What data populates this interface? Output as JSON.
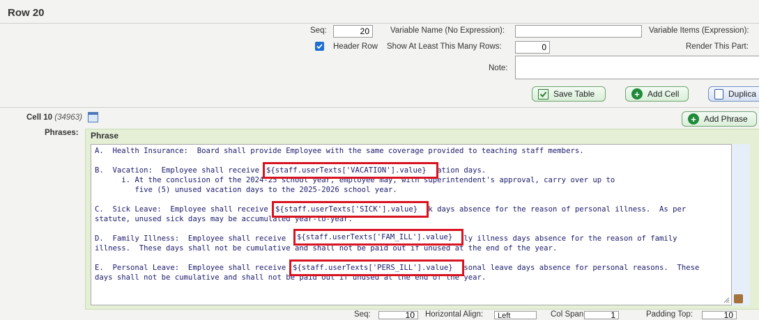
{
  "header": {
    "title": "Row 20"
  },
  "row_form": {
    "seq_label": "Seq:",
    "seq_value": "20",
    "variable_name_label": "Variable Name (No Expression):",
    "variable_name_value": "",
    "variable_items_label": "Variable Items (Expression):",
    "header_row_label": "Header Row",
    "header_row_checked": true,
    "show_rows_label": "Show At Least This Many Rows:",
    "show_rows_value": "0",
    "render_label": "Render This Part:",
    "note_label": "Note:",
    "note_value": ""
  },
  "buttons": {
    "save_table": "Save Table",
    "add_cell": "Add Cell",
    "duplicate": "Duplica",
    "add_phrase": "Add Phrase"
  },
  "cell": {
    "label": "Cell 10",
    "id": "(34963)",
    "phrases_label": "Phrases:",
    "phrase_header": "Phrase"
  },
  "phrase_text": {
    "a": "A.  Health Insurance:  Board shall provide Employee with the same coverage provided to teaching staff members.",
    "b_before": "B.  Vacation:  Employee shall receive",
    "b_var": "${staff.userTexts['VACATION'].value}",
    "b_after": " vacation days.",
    "b_i1": "      i. At the conclusion of the 2024-25 school year, employee may, with superintendent's approval, carry over up to",
    "b_i2": "         five (5) unused vacation days to the 2025-2026 school year.",
    "c_before": "C.  Sick Leave:  Employee shall receive",
    "c_var": "${staff.userTexts['SICK'].value}",
    "c_after": " sick days absence for the reason of personal illness.  As per",
    "c2": "statute, unused sick days may be accumulated year-to-year.",
    "d_before": "D.  Family Illness:  Employee shall receive",
    "d_var": "${staff.userTexts['FAM_ILL'].value}",
    "d_after": " family illness days absence for the reason of family",
    "d2": "illness.  These days shall not be cumulative and shall not be paid out if unused at the end of the year.",
    "e_before": "E.  Personal Leave:  Employee shall receive",
    "e_var": "${staff.userTexts['PERS_ILL'].value}",
    "e_after": " personal leave days absence for personal reasons.  These",
    "e2": "days shall not be cumulative and shall not be paid out if unused at the end of the year."
  },
  "bottom_row": {
    "seq_label": "Seq:",
    "seq_value": "10",
    "halign_label": "Horizontal Align:",
    "halign_value": "Left",
    "colspan_label": "Col Span:",
    "colspan_value": "1",
    "padding_top_label": "Padding Top:",
    "padding_top_value": "10"
  },
  "colors": {
    "highlight": "#d8131f",
    "phrase_panel": "#e4efd6",
    "mono_text": "#1a1a6b"
  }
}
